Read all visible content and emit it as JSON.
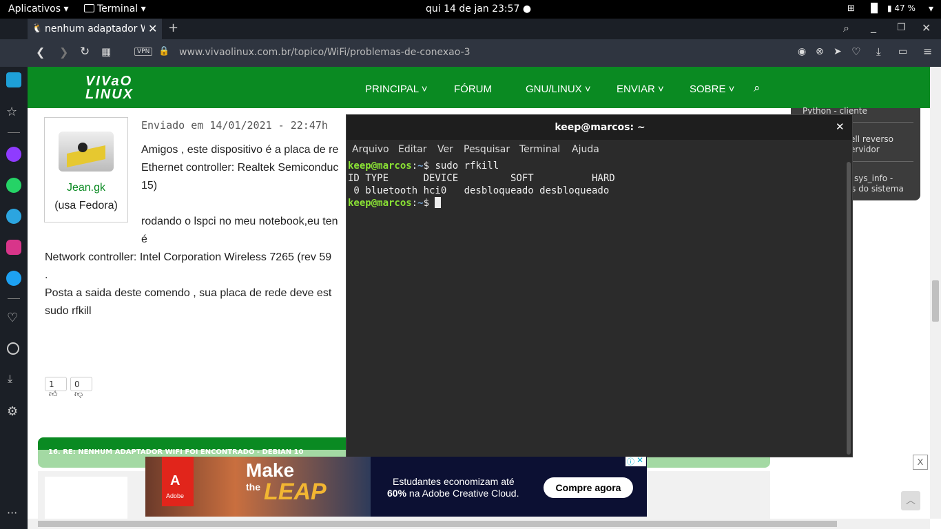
{
  "topbar": {
    "apps": "Aplicativos",
    "terminal": "Terminal",
    "clock": "qui 14 de jan  23:57",
    "battery": "47 %"
  },
  "browser": {
    "tab_title": "nenhum adaptador W",
    "url": "www.vivaolinux.com.br/topico/WiFi/problemas-de-conexao-3",
    "vpn": "VPN"
  },
  "site": {
    "logo_line1": "VIVaO",
    "logo_line2": "LINUX",
    "nav": [
      "PRINCIPAL",
      "FÓRUM",
      "GNU/LINUX",
      "ENVIAR",
      "SOBRE"
    ],
    "sidebox": [
      "Python - cliente",
      "ell reverso",
      "ervidor",
      "sys_info -",
      "s do sistema"
    ]
  },
  "post": {
    "date": "Enviado em 14/01/2021 - 22:47h",
    "author": "Jean.gk",
    "distro": "(usa Fedora)",
    "lines": [
      "Amigos , este dispositivo é a placa de re",
      "Ethernet controller: Realtek Semiconduc",
      "15)",
      "rodando o lspci no meu notebook,eu ten",
      "é",
      "Network controller: Intel Corporation Wireless 7265 (rev 59",
      ".",
      "Posta a saida deste comendo , sua placa de rede deve est",
      "sudo rfkill"
    ],
    "likes": "1",
    "dislikes": "0",
    "next_title": "16. RE: NENHUM ADAPTADOR WIFI FOI ENCONTRADO - DEBIAN 10"
  },
  "terminal": {
    "title": "keep@marcos: ~",
    "menu": [
      "Arquivo",
      "Editar",
      "Ver",
      "Pesquisar",
      "Terminal",
      "Ajuda"
    ],
    "prompt_user": "keep@marcos",
    "prompt_path": "~",
    "command": "sudo rfkill",
    "output": [
      "ID TYPE      DEVICE         SOFT          HARD",
      " 0 bluetooth hci0   desbloqueado desbloqueado"
    ]
  },
  "ad": {
    "make": "Make",
    "the": "the",
    "leap": "LEAP",
    "brand": "Adobe",
    "text_line1": "Estudantes economizam até",
    "text_pct": "60%",
    "text_rest": " na Adobe Creative Cloud.",
    "cta": "Compre agora",
    "close": "X"
  }
}
